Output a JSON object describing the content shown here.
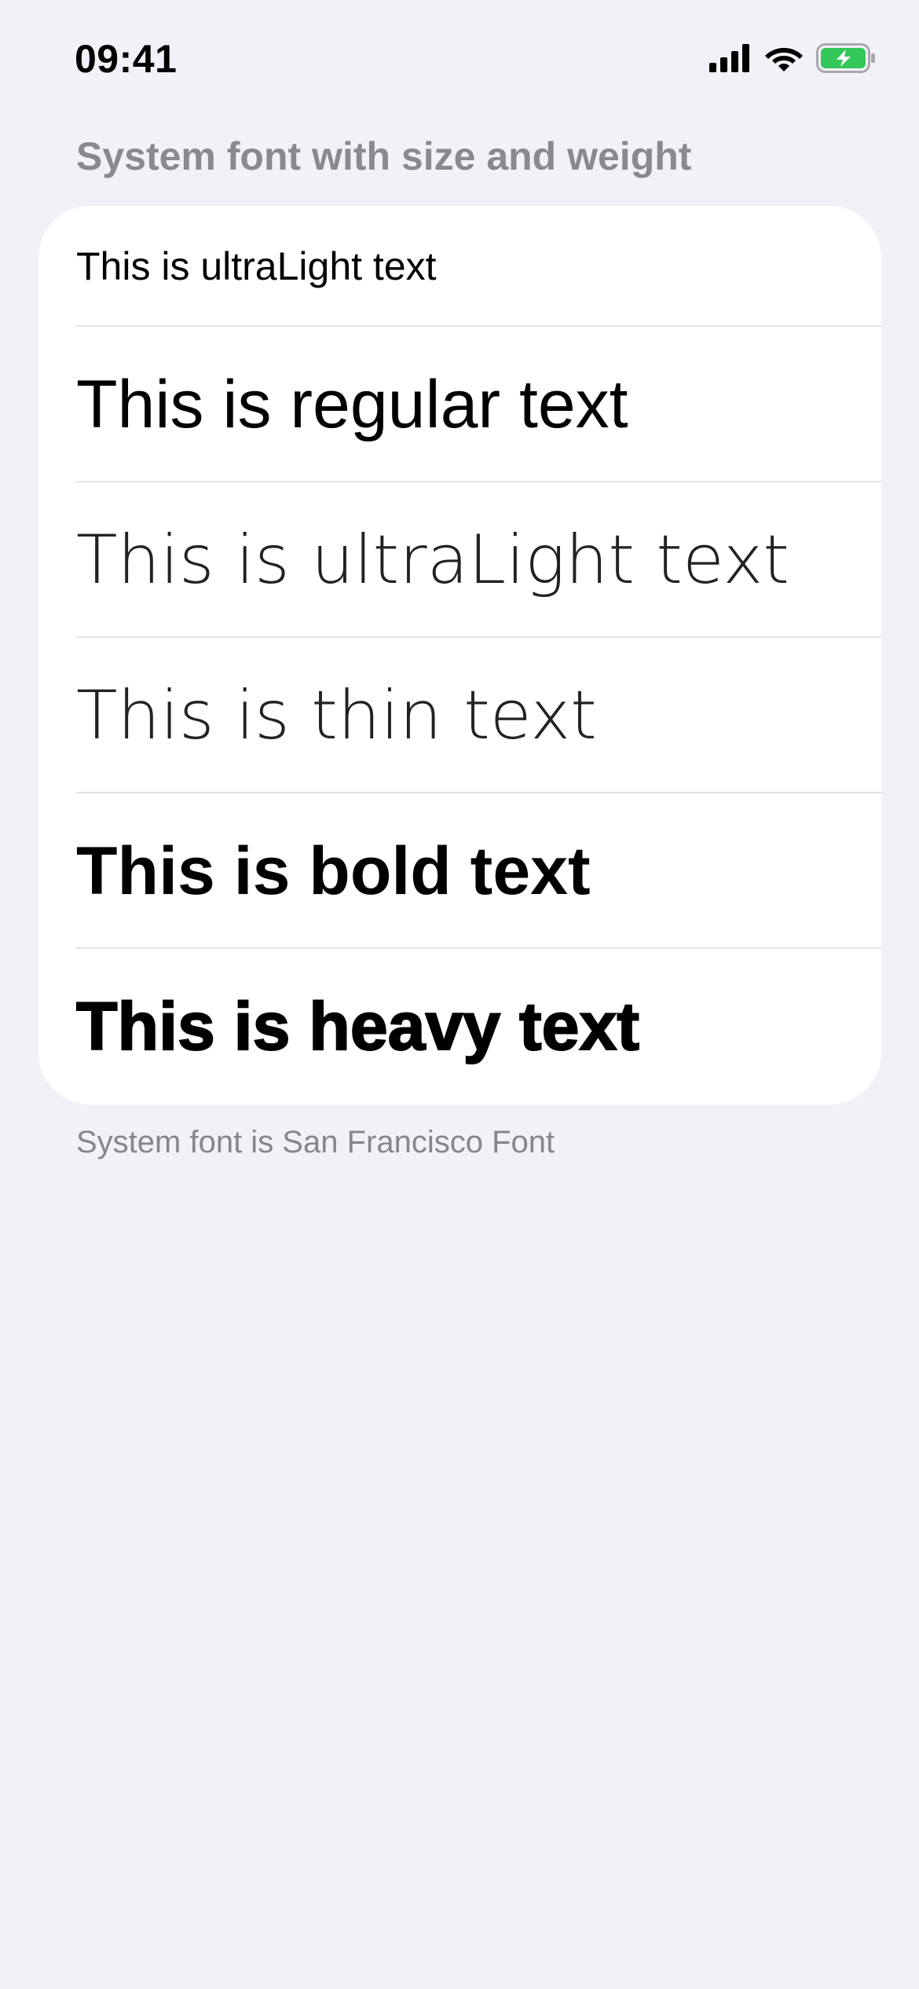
{
  "status_bar": {
    "time": "09:41",
    "icons": [
      "cellular-signal-icon",
      "wifi-icon",
      "battery-charging-icon"
    ],
    "battery_color": "#34c759"
  },
  "section": {
    "header": "System font with size and weight",
    "rows": [
      {
        "label": "This is ultraLight text"
      },
      {
        "label": "This is regular text"
      },
      {
        "label": "This is ultraLight text"
      },
      {
        "label": "This is thin text"
      },
      {
        "label": "This is bold text"
      },
      {
        "label": "This is heavy text"
      }
    ],
    "footer": "System font is San Francisco Font"
  },
  "colors": {
    "background": "#f2f1f7",
    "card": "#ffffff",
    "secondary_text": "#8a8a8e",
    "divider": "#e3e3e6"
  }
}
